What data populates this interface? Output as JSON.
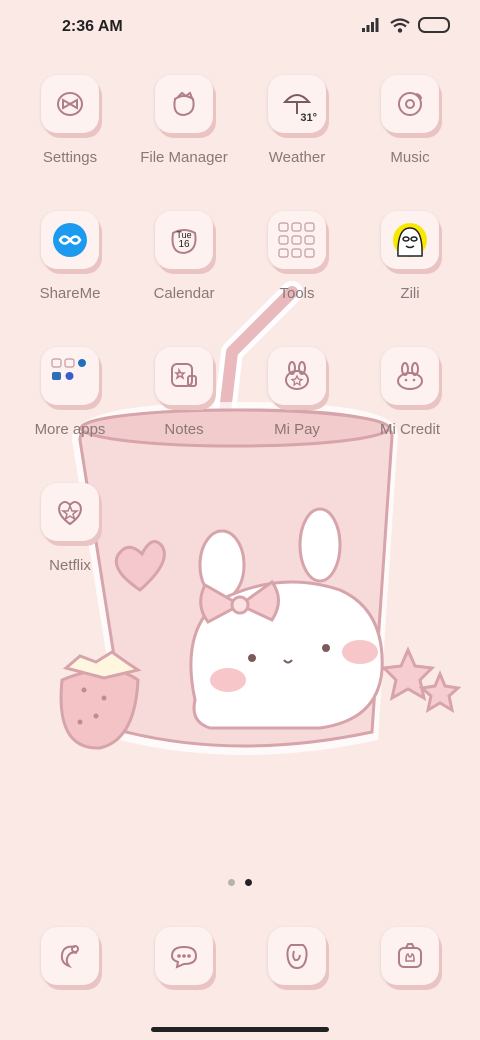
{
  "status_bar": {
    "time": "2:36 AM"
  },
  "apps": [
    {
      "label": "Settings"
    },
    {
      "label": "File Manager"
    },
    {
      "label": "Weather",
      "temp": "31°"
    },
    {
      "label": "Music"
    },
    {
      "label": "ShareMe"
    },
    {
      "label": "Calendar",
      "day": "Tue",
      "date": "16"
    },
    {
      "label": "Tools"
    },
    {
      "label": "Zili"
    },
    {
      "label": "More apps"
    },
    {
      "label": "Notes"
    },
    {
      "label": "Mi Pay"
    },
    {
      "label": "Mi Credit"
    },
    {
      "label": "Netflix"
    }
  ],
  "page_indicator": {
    "pages": 2,
    "current": 2
  },
  "dock": [
    {
      "icon": "shrimp-icon"
    },
    {
      "icon": "messages-icon"
    },
    {
      "icon": "browser-icon"
    },
    {
      "icon": "camera-icon"
    }
  ],
  "colors": {
    "background": "#fbe9e6",
    "icon_line": "#b07e86",
    "accent_pink": "#f0c4c6"
  }
}
